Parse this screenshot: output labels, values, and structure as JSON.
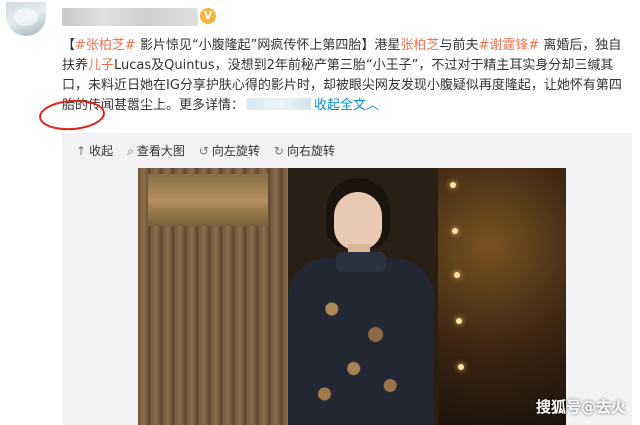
{
  "header": {
    "verified_badge": "V"
  },
  "post": {
    "tag_open": "【",
    "hashtag1": "#张柏芝#",
    "title_rest": " 影片惊见“小腹隆起”网疯传怀上第四胎】港星",
    "name_link": "张柏芝",
    "text1": "与前夫",
    "hashtag2": "#谢霆锋#",
    "text2": " 离婚后，独自扶养",
    "son_link": "儿子",
    "text3": "Lucas及Quintus，没想到2年前秘产第三胎“小王子”，不过对于精主耳实身分却三缄其口，未料近日她在IG分享护肤心得的影片时，却被眼尖网友发现小腹疑似再度隆起，让她怀有第四胎的传闻甚嚣尘上。更多详情：",
    "collapse": "收起全文",
    "collapse_arrow": "︿"
  },
  "toolbar": [
    {
      "icon": "↑",
      "label": "收起"
    },
    {
      "icon": "⌕",
      "label": "查看大图"
    },
    {
      "icon": "↺",
      "label": "向左旋转"
    },
    {
      "icon": "↻",
      "label": "向右旋转"
    }
  ],
  "watermark": "搜狐号@去火",
  "colors": {
    "hashtag": "#eb7350",
    "link": "#0a8cd2",
    "annotation_ring": "#e0221b"
  }
}
